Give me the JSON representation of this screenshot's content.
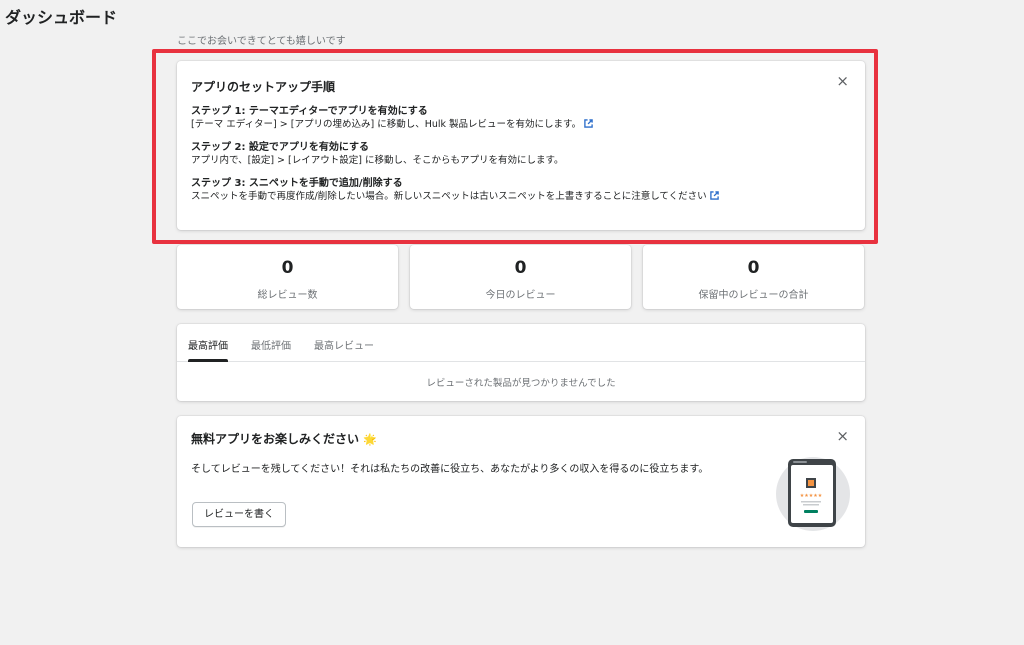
{
  "page": {
    "title": "ダッシュボード",
    "subtitle": "ここでお会いできてとても嬉しいです"
  },
  "setup": {
    "title": "アプリのセットアップ手順",
    "close_icon": "×",
    "steps": [
      {
        "title": "ステップ 1: テーマエディターでアプリを有効にする",
        "desc": "[テーマ エディター] > [アプリの埋め込み] に移動し、Hulk 製品レビューを有効にします。",
        "has_link": true
      },
      {
        "title": "ステップ 2: 設定でアプリを有効にする",
        "desc": "アプリ内で、[設定] > [レイアウト設定] に移動し、そこからもアプリを有効にします。",
        "has_link": false
      },
      {
        "title": "ステップ 3: スニペットを手動で追加/削除する",
        "desc": "スニペットを手動で再度作成/削除したい場合。新しいスニペットは古いスニペットを上書きすることに注意してください",
        "has_link": true
      }
    ]
  },
  "stats": [
    {
      "value": "0",
      "label": "総レビュー数"
    },
    {
      "value": "0",
      "label": "今日のレビュー"
    },
    {
      "value": "0",
      "label": "保留中のレビューの合計"
    }
  ],
  "tabs": {
    "items": [
      "最高評価",
      "最低評価",
      "最高レビュー"
    ],
    "active": "最高評価",
    "empty_text": "レビューされた製品が見つかりませんでした"
  },
  "promo": {
    "title": "無料アプリをお楽しみください",
    "title_emoji": "🌟",
    "desc": "そしてレビューを残してください！それは私たちの改善に役立ち、あなたがより多くの収入を得るのに役立ちます。",
    "button_label": "レビューを書く",
    "close_icon": "×"
  },
  "colors": {
    "highlight_border": "#e8323f",
    "link_icon": "#2c6ecb",
    "illustration_green": "#008060",
    "star": "#f49342"
  }
}
